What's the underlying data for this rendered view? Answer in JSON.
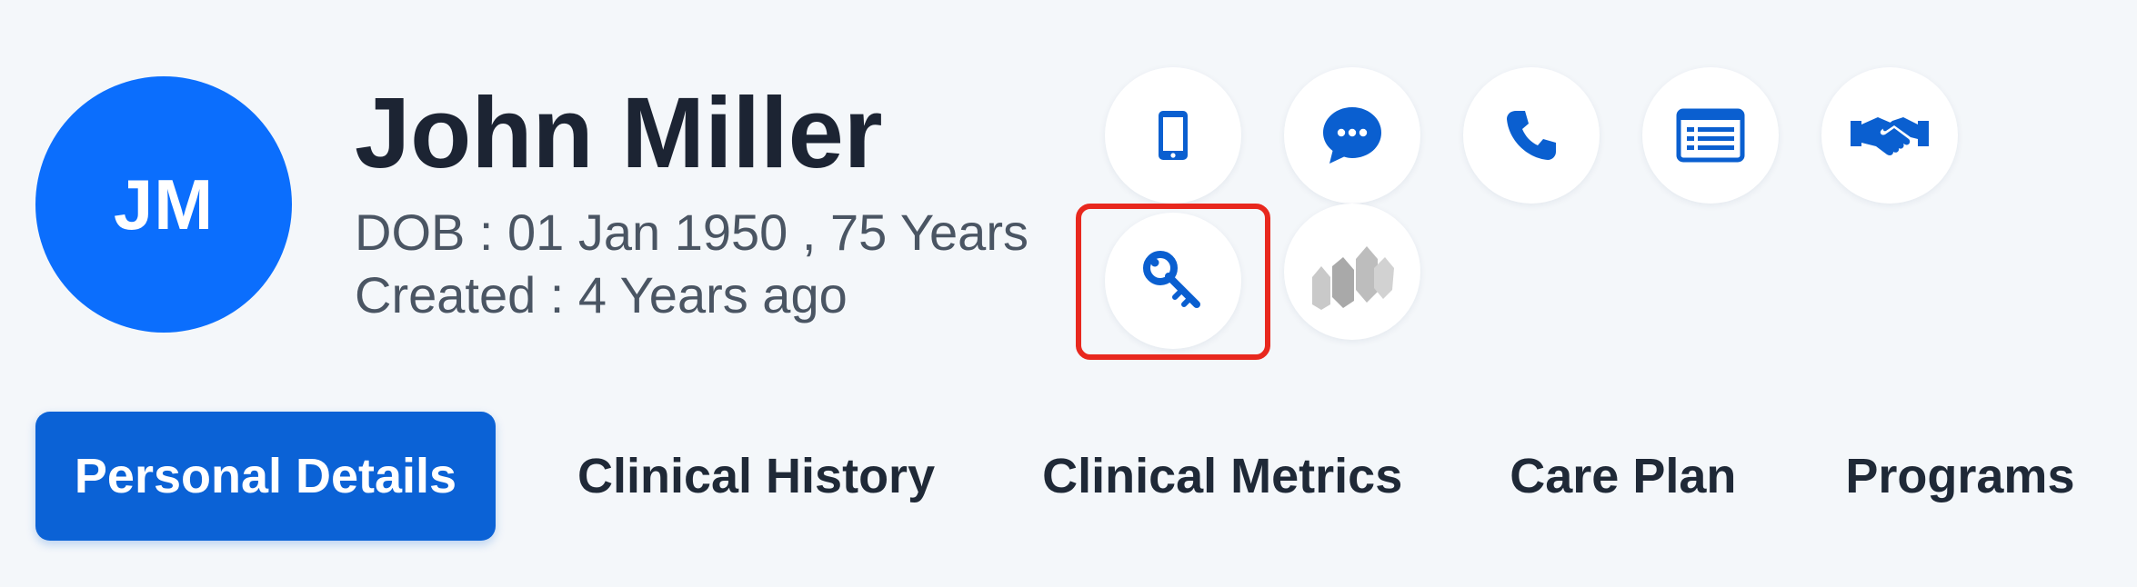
{
  "patient": {
    "initials": "JM",
    "name": "John Miller",
    "dob_line": "DOB : 01 Jan 1950 , 75 Years",
    "created_line": "Created : 4 Years ago"
  },
  "actions": [
    {
      "icon": "mobile-phone-icon"
    },
    {
      "icon": "chat-bubble-icon"
    },
    {
      "icon": "phone-icon"
    },
    {
      "icon": "list-card-icon"
    },
    {
      "icon": "handshake-icon"
    },
    {
      "icon": "key-icon",
      "highlighted": true
    },
    {
      "icon": "brand-logo-icon"
    }
  ],
  "tabs": [
    {
      "label": "Personal Details",
      "active": true
    },
    {
      "label": "Clinical History",
      "active": false
    },
    {
      "label": "Clinical Metrics",
      "active": false
    },
    {
      "label": "Care Plan",
      "active": false
    },
    {
      "label": "Programs",
      "active": false
    }
  ],
  "colors": {
    "accent": "#0b6efd",
    "icon": "#0a5fd0",
    "active_tab": "#0b62d6",
    "highlight": "#e8281e"
  }
}
